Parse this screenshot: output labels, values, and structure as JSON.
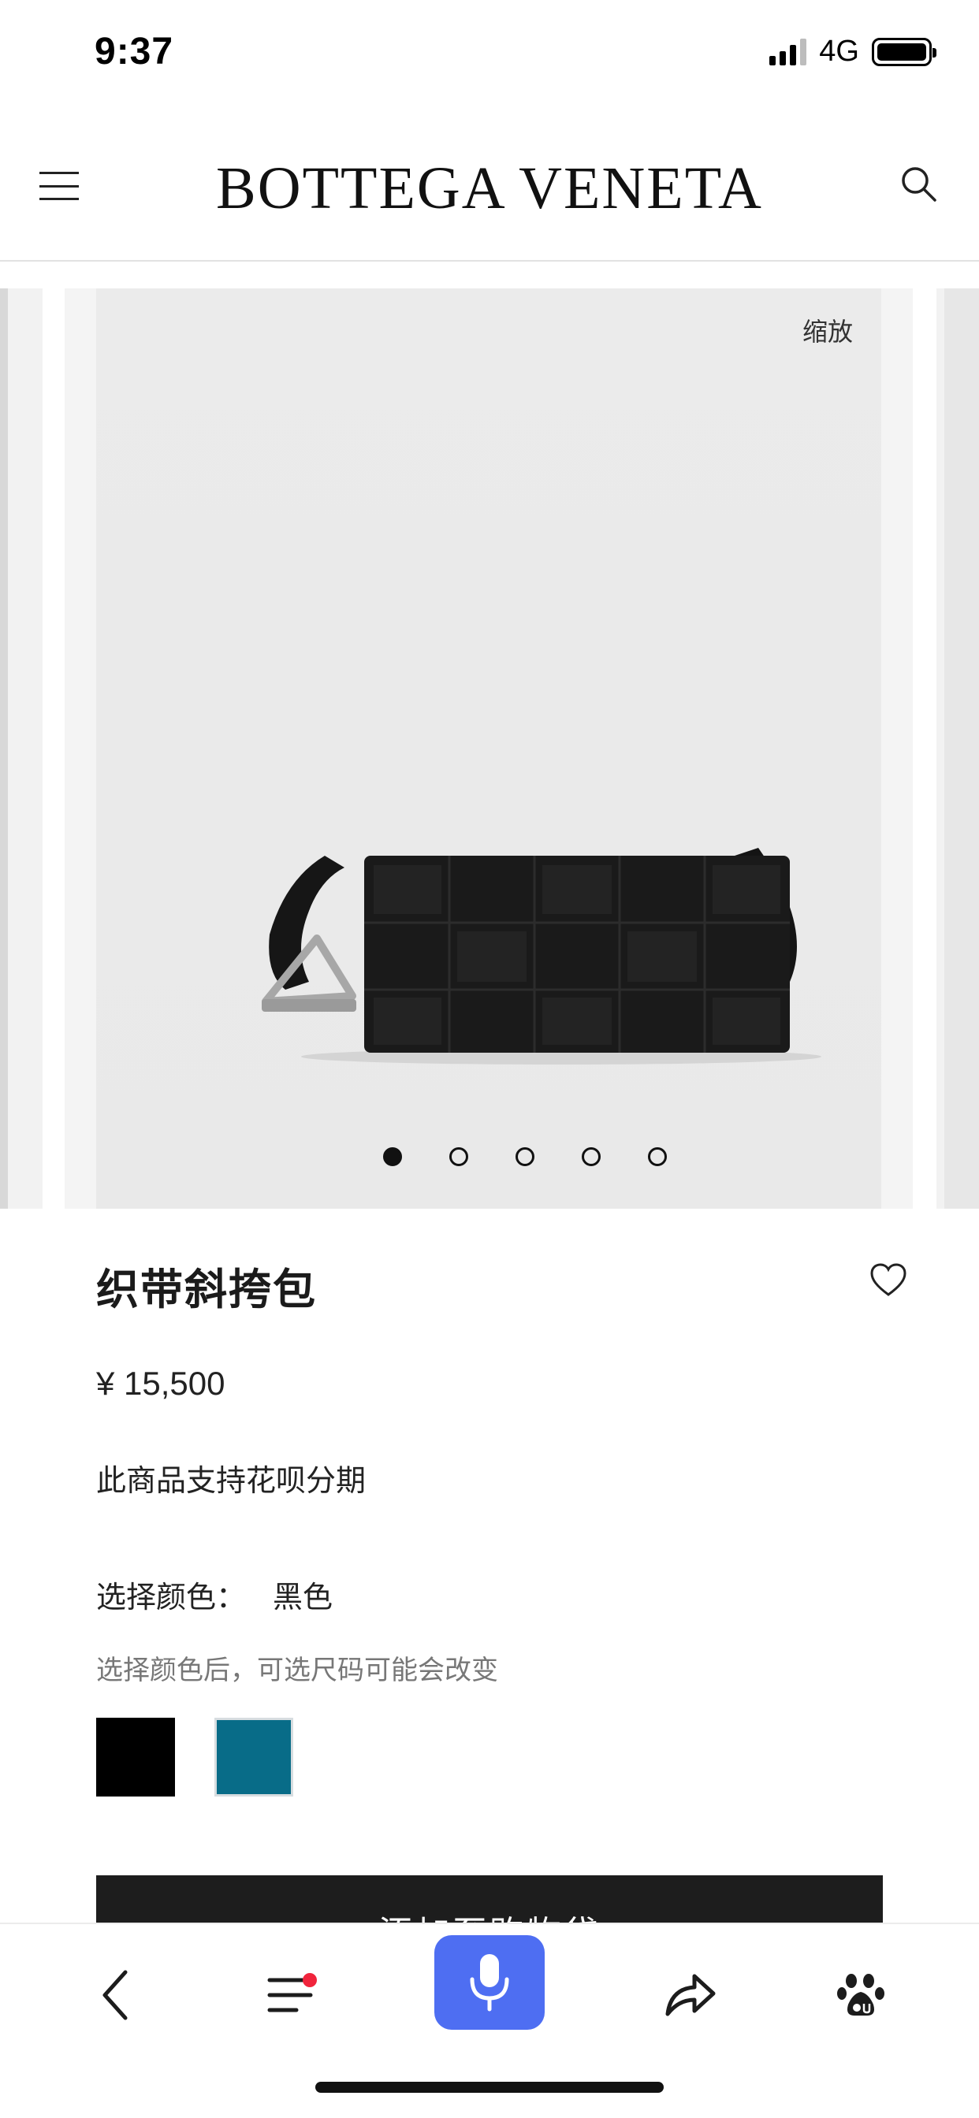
{
  "status_bar": {
    "time": "9:37",
    "network": "4G",
    "icons": [
      "signal-icon",
      "battery-icon"
    ]
  },
  "header": {
    "brand": "BOTTEGA VENETA",
    "icons": [
      "menu-icon",
      "search-icon"
    ]
  },
  "gallery": {
    "zoom_label": "缩放",
    "slide_count": 5,
    "active_slide": 1
  },
  "product": {
    "title": "织带斜挎包",
    "price": "¥ 15,500",
    "installment_note": "此商品支持花呗分期",
    "color_label": "选择颜色：",
    "selected_color": "黑色",
    "color_note": "选择颜色后，可选尺码可能会改变",
    "swatches": [
      {
        "name": "black",
        "color": "#000000"
      },
      {
        "name": "teal",
        "color": "#086c88"
      }
    ],
    "add_to_bag": "添加至购物袋"
  },
  "toolbar": {
    "icons": [
      "back-icon",
      "tabs-icon",
      "mic-icon",
      "share-icon",
      "baidu-icon"
    ],
    "accent": "#4e6ef2",
    "notification_color": "#f0243c"
  }
}
